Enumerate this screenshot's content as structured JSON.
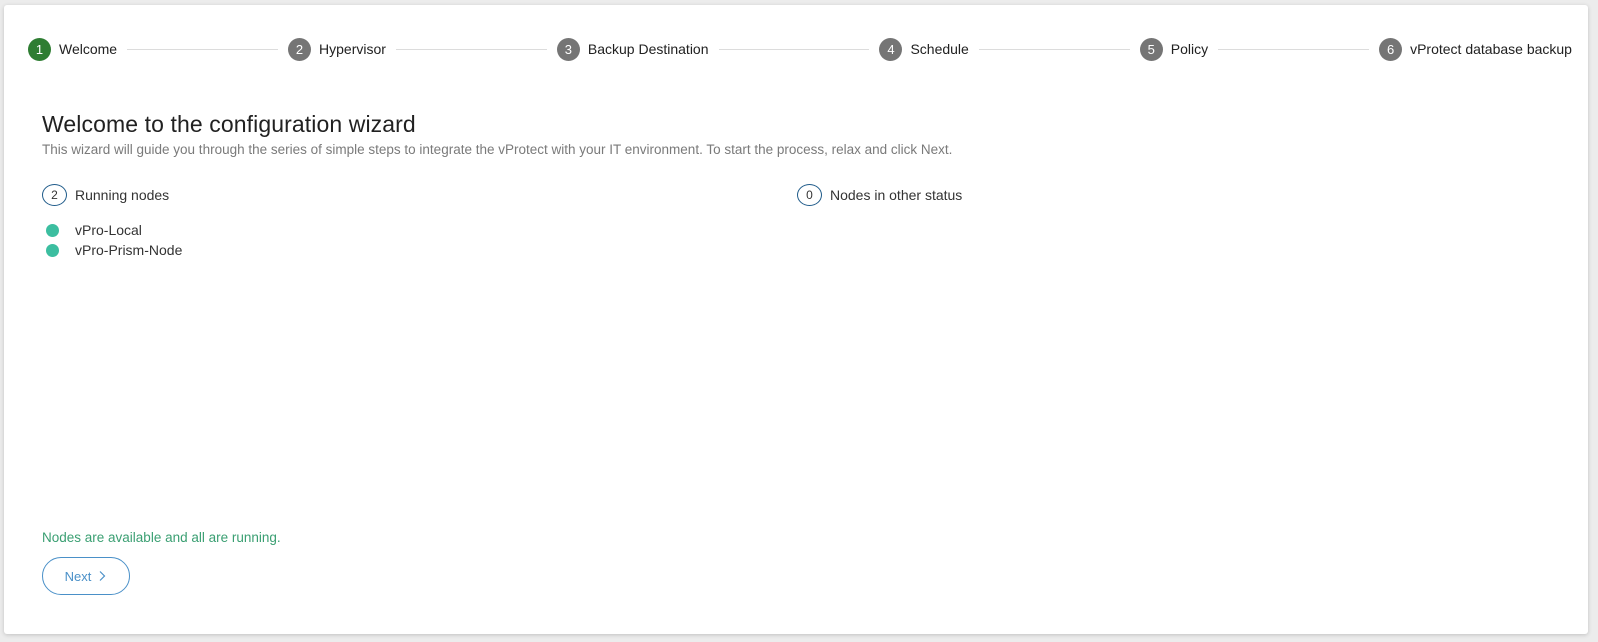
{
  "wizard": {
    "steps": [
      {
        "number": "1",
        "label": "Welcome",
        "active": true
      },
      {
        "number": "2",
        "label": "Hypervisor",
        "active": false
      },
      {
        "number": "3",
        "label": "Backup Destination",
        "active": false
      },
      {
        "number": "4",
        "label": "Schedule",
        "active": false
      },
      {
        "number": "5",
        "label": "Policy",
        "active": false
      },
      {
        "number": "6",
        "label": "vProtect database backup",
        "active": false
      }
    ],
    "active_color": "#2e7d32",
    "inactive_color": "#757575"
  },
  "main": {
    "title": "Welcome to the configuration wizard",
    "subtitle": "This wizard will guide you through the series of simple steps to integrate the vProtect with your IT environment. To start the process, relax and click Next.",
    "running_nodes": {
      "count": "2",
      "label": "Running nodes",
      "items": [
        {
          "name": "vPro-Local",
          "status_color": "#3cbea0"
        },
        {
          "name": "vPro-Prism-Node",
          "status_color": "#3cbea0"
        }
      ]
    },
    "other_nodes": {
      "count": "0",
      "label": "Nodes in other status"
    },
    "status_message": "Nodes are available and all are running.",
    "status_message_color": "#3a9f72",
    "next_label": "Next",
    "next_icon": "chevron-right-icon",
    "accent_color": "#4a90c8"
  }
}
